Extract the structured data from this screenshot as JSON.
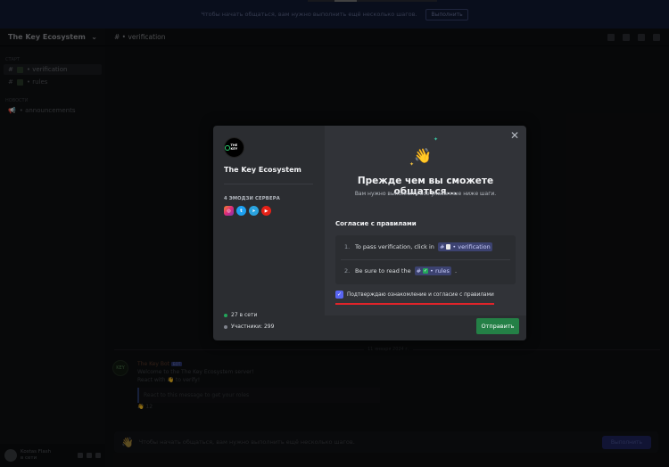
{
  "notice": {
    "text": "Чтобы начать общаться, вам нужно выполнить ещё несколько шагов.",
    "button": "Выполнить"
  },
  "sidebar": {
    "server_title": "The Key Ecosystem",
    "categories": [
      {
        "name": "Старт",
        "channels": [
          "• verification",
          "• rules"
        ]
      },
      {
        "name": "Новости",
        "channels": [
          "• announcements"
        ]
      }
    ],
    "user": {
      "name": "Kostas Flash",
      "status": "в сети"
    }
  },
  "channel_header": {
    "title": "• verification"
  },
  "chat": {
    "date": "11 января 2024 г.",
    "message": {
      "author": "The Key Bot",
      "badge": "БОТ",
      "line1": "Welcome to the The Key Ecosystem server!",
      "line2": "React with 👋 to verify!",
      "quote": "React to this message to get your roles",
      "reaction_count": "12"
    },
    "composer_text": "Чтобы начать общаться, вам нужно выполнить ещё несколько шагов.",
    "composer_button": "Выполнить"
  },
  "modal": {
    "server_name": "The Key Ecosystem",
    "logo_text": "THE KEY",
    "emoji_label": "4 ЭМОДЗИ СЕРВЕРА",
    "emojis": [
      "instagram-icon",
      "twitter-icon",
      "telegram-icon",
      "youtube-icon"
    ],
    "online": "27 в сети",
    "members": "Участники: 299",
    "title": "Прежде чем вы сможете общаться...",
    "subtitle": "Вам нужно выполнить все указанные ниже шаги.",
    "rules_heading": "Согласие с правилами",
    "rules": [
      {
        "num": "1.",
        "text": "To pass verification, click in",
        "channel": "• verification",
        "suffix": ""
      },
      {
        "num": "2.",
        "text": "Be sure to read the",
        "channel": "• rules",
        "suffix": "."
      }
    ],
    "agree_text": "Подтверждаю ознакомление и согласие с правилами",
    "submit_label": "Отправить",
    "colors": {
      "accent": "#5865f2",
      "submit": "#248046",
      "highlight": "#e0242a"
    }
  }
}
